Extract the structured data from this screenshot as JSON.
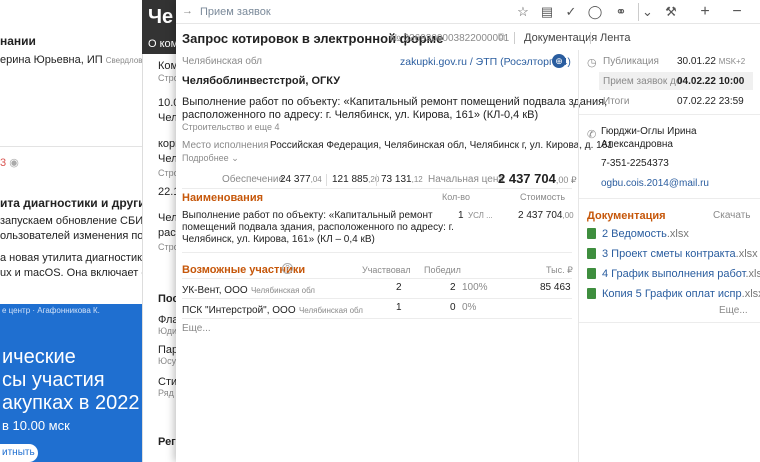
{
  "background": {
    "col1": {
      "line1": "нании",
      "line2": "ерина Юрьевна, ИП",
      "line2_region": "Свердловская обл",
      "views": "3",
      "headline": "ита диагностики и другие из",
      "body1": "запускаем обновление СБИС до",
      "body2": "ользователей изменения появят",
      "body3": "а новая утилита диагностики для",
      "body4": "ux и macOS. Она включает сбор т",
      "banner_small": "е центр · Агафонникова К.",
      "banner_l1": "ические",
      "banner_l2": "сы участия",
      "banner_l3": "акупках в 2022",
      "banner_l4": "в 10.00 мск",
      "banner_btn": "итныть"
    },
    "col2": {
      "top1": "Че",
      "top2": "О ком",
      "a1": "Ком",
      "a2": "Строи",
      "b1": "10.0",
      "b2": "Челя",
      "b3": "корп",
      "b4": "Челя",
      "b5": "Строи",
      "c1": "22.1",
      "c2": "Челя",
      "c3": "расп",
      "c4": "Строи",
      "d1": "Пос",
      "d2": "Фла",
      "d3": "Юди",
      "d4": "Пар",
      "d5": "Юсу",
      "d6": "Сти",
      "d7": "Ряд",
      "d8": "Реги"
    }
  },
  "topbar": {
    "title": "Прием заявок"
  },
  "header": {
    "title": "Запрос котировок в электронной форме",
    "number": "№ 0369200003822000001",
    "tab_docs": "Документация",
    "tab_feed": "Лента"
  },
  "main": {
    "region": "Челябинская обл",
    "platform": "zakupki.gov.ru / ЭТП (Росэлторг 44)",
    "customer": "Челябоблинвестстрой, ОГКУ",
    "subject_l1": "Выполнение работ по объекту: «Капитальный ремонт помещений подвала здания,",
    "subject_l2": "расположенного по адресу: г. Челябинск, ул. Кирова, 161» (КЛ-0,4 кВ)",
    "category": "Строительство и еще 4",
    "place_label": "Место исполнения",
    "place_value": "Российская Федерация, Челябинская обл, Челябинск г, ул. Кирова, д. 161",
    "more": "Подробнее",
    "security_label": "Обеспечение",
    "sec1": "24 377",
    "sec1_dec": ",04",
    "sec2": "121 885",
    "sec2_dec": ",20",
    "sec3": "73 131",
    "sec3_dec": ",12",
    "price_label": "Начальная цена",
    "price": "2 437 704",
    "price_dec": ",00 ₽",
    "items_title": "Наименования",
    "items_qty": "Кол-во",
    "items_cost": "Стоимость",
    "item_l1": "Выполнение работ по объекту: «Капитальный ремонт",
    "item_l2": "помещений подвала здания, расположенного по адресу: г.",
    "item_l3": "Челябинск, ул. Кирова, 161» (КЛ – 0,4 кВ)",
    "item_qty": "1",
    "item_unit": "УСЛ ...",
    "item_cost": "2 437 704",
    "item_cost_dec": ",00",
    "parts_title": "Возможные участники",
    "parts_col1": "Участвовал",
    "parts_col2": "Победил",
    "parts_col3": "Тыс. ₽",
    "p1_name": "УК-Вент, ООО",
    "p1_region": "Челябинская обл",
    "p1_part": "2",
    "p1_win": "2",
    "p1_pct": "100%",
    "p1_sum": "85 463",
    "p2_name": "ПСК \"Интерстрой\", ООО",
    "p2_region": "Челябинская обл",
    "p2_part": "1",
    "p2_win": "0",
    "p2_pct": "0%",
    "more_parts": "Еще..."
  },
  "side": {
    "pub_label": "Публикация",
    "pub_value": "30.01.22",
    "pub_tz": "MSK+2",
    "recv_label": "Прием заявок до",
    "recv_value": "04.02.22 10:00",
    "res_label": "Итоги",
    "res_value": "07.02.22 23:59",
    "contact_l1": "Гюрджи-Оглы Ирина",
    "contact_l2": "Александровна",
    "phone": "7-351-2254373",
    "email": "ogbu.cois.2014@mail.ru",
    "docs_title": "Документация",
    "download": "Скачать",
    "docs": [
      {
        "name": "2 Ведомость",
        "ext": ".xlsx"
      },
      {
        "name": "3 Проект сметы контракта",
        "ext": ".xlsx"
      },
      {
        "name": "4 График выполнения работ",
        "ext": ".xlsx"
      },
      {
        "name": "Копия 5 График оплат испр",
        "ext": ".xlsx"
      }
    ],
    "more_docs": "Еще..."
  }
}
